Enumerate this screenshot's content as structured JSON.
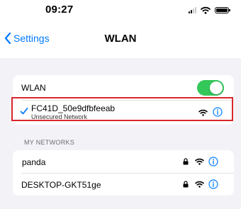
{
  "status_bar": {
    "time": "09:27"
  },
  "nav": {
    "back_label": "Settings",
    "title": "WLAN"
  },
  "wlan_row": {
    "label": "WLAN",
    "toggle_on": true
  },
  "connected_network": {
    "name": "FC41D_50e9dfbfeeab",
    "subtitle": "Unsecured Network"
  },
  "my_networks": {
    "header": "MY NETWORKS",
    "items": [
      {
        "name": "panda",
        "locked": true
      },
      {
        "name": "DESKTOP-GKT51ge",
        "locked": true
      }
    ]
  },
  "colors": {
    "accent": "#007aff",
    "toggle_on": "#34c759",
    "highlight": "#d9262c",
    "background": "#f2f2f7"
  }
}
